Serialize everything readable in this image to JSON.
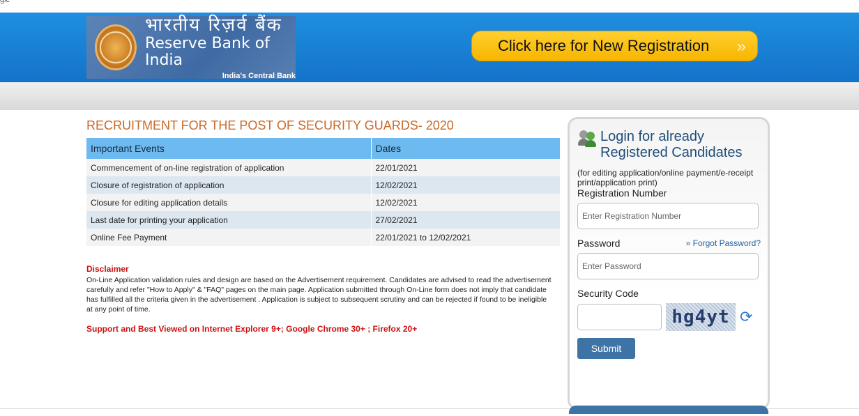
{
  "browser": {
    "tab_fragment": "gic"
  },
  "header": {
    "logo_hindi": "भारतीय रिज़र्व बैंक",
    "logo_english": "Reserve Bank of India",
    "logo_tagline": "India's Central Bank",
    "registration_button": "Click here for New Registration",
    "registration_chevron": "»"
  },
  "main": {
    "title": "RECRUITMENT FOR THE POST OF SECURITY GUARDS- 2020",
    "table_headers": [
      "Important Events",
      "Dates"
    ],
    "rows": [
      {
        "event": "Commencement of on-line registration of application",
        "date": "22/01/2021"
      },
      {
        "event": "Closure of registration of application",
        "date": "12/02/2021"
      },
      {
        "event": "Closure for editing application details",
        "date": "12/02/2021"
      },
      {
        "event": "Last date for printing your application",
        "date": "27/02/2021"
      },
      {
        "event": "Online Fee Payment",
        "date": "22/01/2021 to 12/02/2021"
      }
    ],
    "disclaimer_title": "Disclaimer",
    "disclaimer_text": "On-Line Application validation rules and design are based on the Advertisement requirement. Candidates are advised to read the advertisement carefully and refer \"How to Apply\" & \"FAQ\" pages on the main page. Application submitted through On-Line form does not imply that candidate has fulfilled all the criteria given in the advertisement . Application is subject to subsequent scrutiny and can be rejected if found to be ineligible at any point of time.",
    "support_text": "Support and Best Viewed on Internet Explorer 9+; Google Chrome 30+ ; Firefox 20+"
  },
  "login": {
    "title_line1": "Login for already",
    "title_line2": "Registered Candidates",
    "subtitle": "(for editing application/online payment/e-receipt print/application print)",
    "reg_label": "Registration Number",
    "reg_placeholder": "Enter Registration Number",
    "password_label": "Password",
    "forgot_label": "Forgot Password?",
    "password_placeholder": "Enter Password",
    "security_label": "Security Code",
    "captcha_text": "hg4yt",
    "submit_label": "Submit"
  }
}
